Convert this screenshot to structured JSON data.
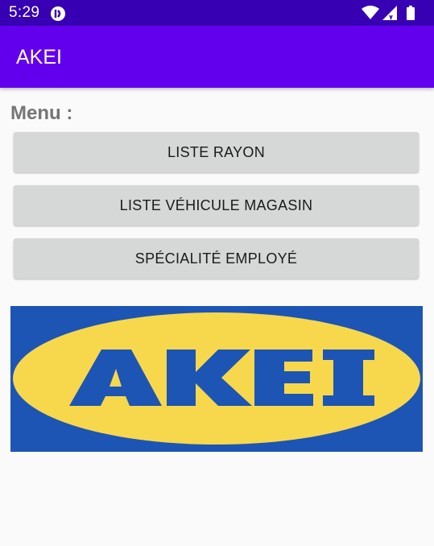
{
  "status_bar": {
    "time": "5:29",
    "icons": [
      "app-notification-icon",
      "wifi-icon",
      "signal-icon",
      "battery-icon"
    ]
  },
  "app_bar": {
    "title": "AKEI",
    "color": "#6200ee"
  },
  "menu": {
    "label": "Menu :",
    "buttons": [
      "LISTE RAYON",
      "LISTE VÉHICULE MAGASIN",
      "SPÉCIALITÉ EMPLOYÉ"
    ]
  },
  "logo": {
    "text": "AKEI",
    "background_color": "#1d55b5",
    "ellipse_color": "#f7d84c"
  }
}
